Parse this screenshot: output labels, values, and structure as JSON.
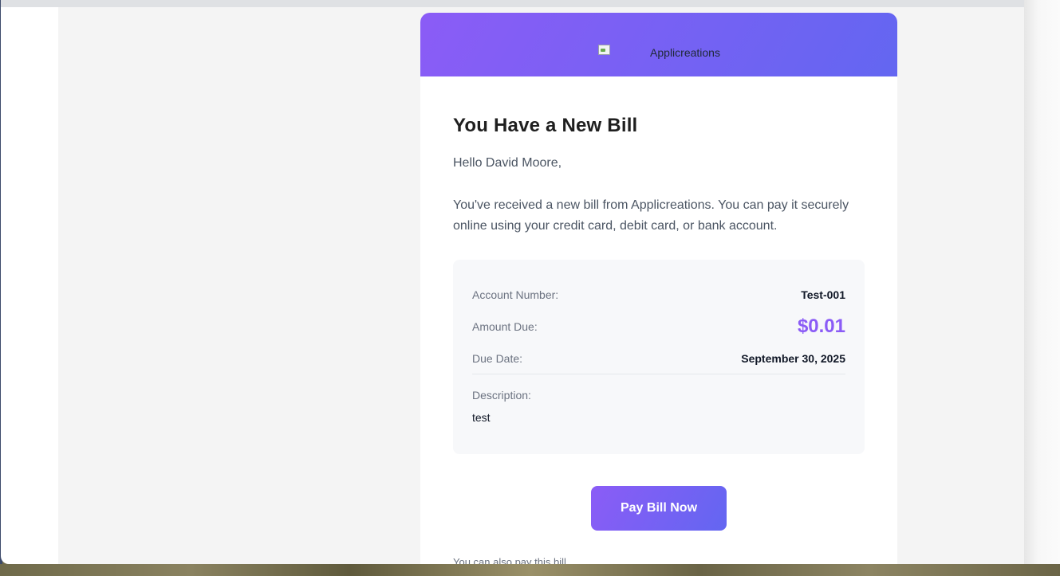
{
  "email": {
    "logo_alt": "Applicreations",
    "title": "You Have a New Bill",
    "greeting": "Hello David Moore,",
    "intro": "You've received a new bill from Applicreations. You can pay it securely online using your credit card, debit card, or bank account.",
    "bill": {
      "account_label": "Account Number:",
      "account_value": "Test-001",
      "amount_label": "Amount Due:",
      "amount_value": "$0.01",
      "due_label": "Due Date:",
      "due_value": "September 30, 2025",
      "description_label": "Description:",
      "description_value": "test"
    },
    "pay_button": "Pay Bill Now",
    "footer_partial": "You can also pay this bill..."
  },
  "colors": {
    "accent": "#8b5cf6",
    "accent_end": "#6366f1"
  }
}
